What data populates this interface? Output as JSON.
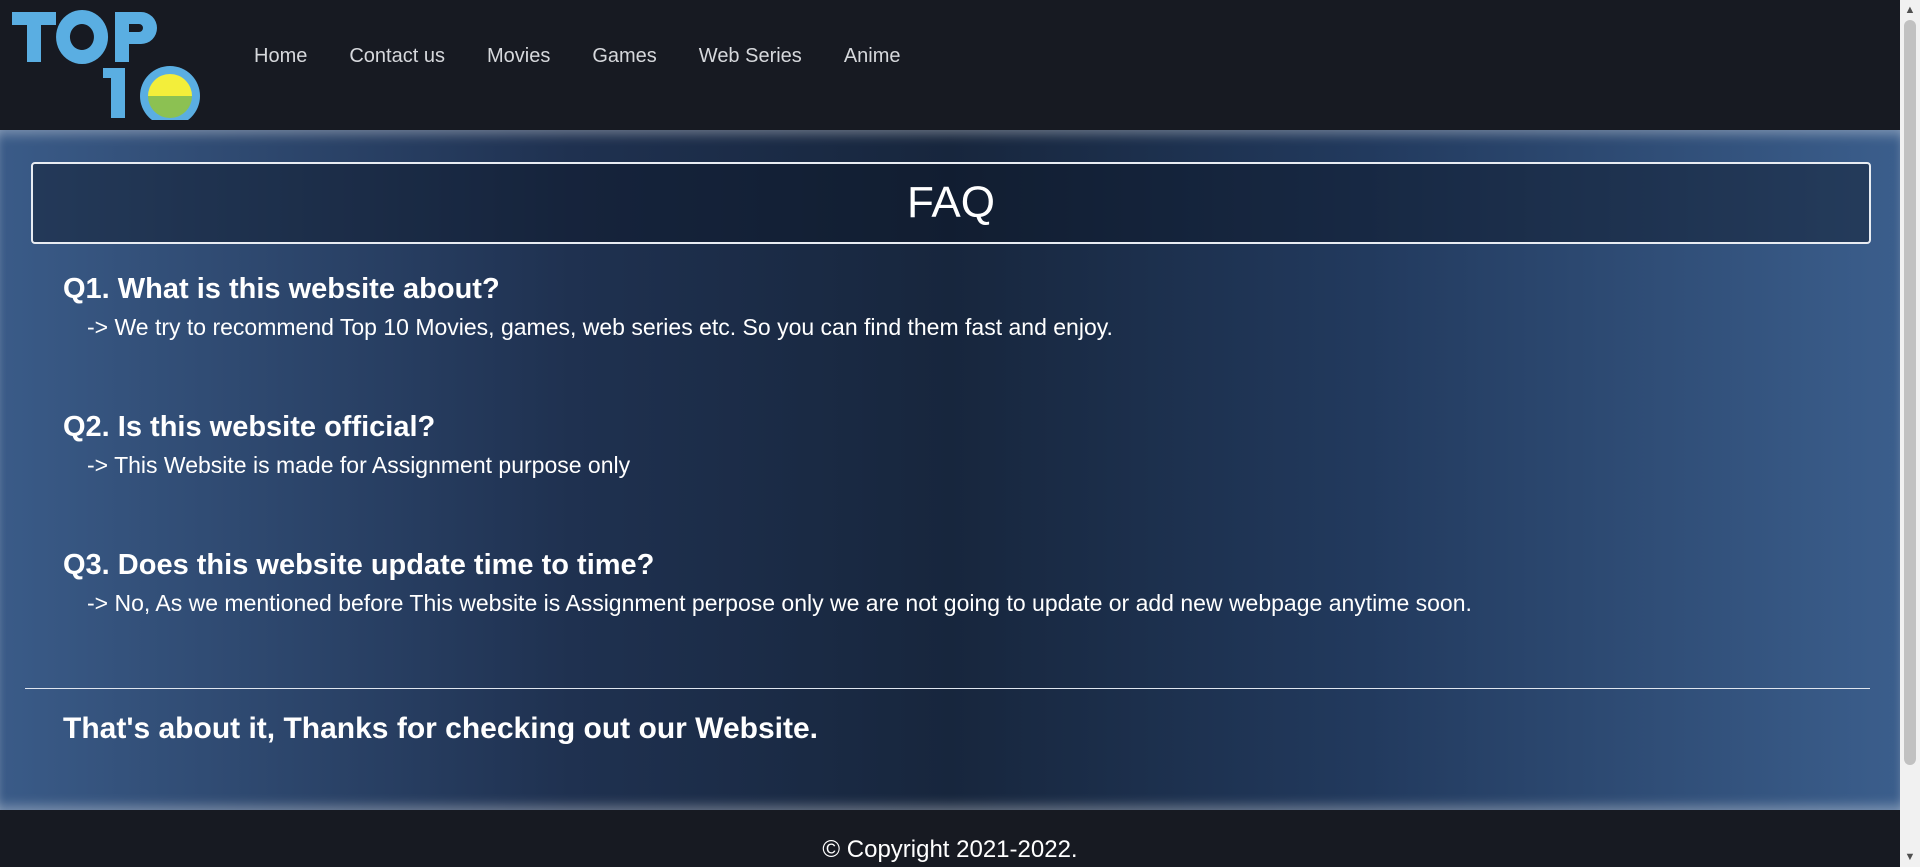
{
  "nav": {
    "items": [
      "Home",
      "Contact us",
      "Movies",
      "Games",
      "Web Series",
      "Anime"
    ]
  },
  "logo": {
    "text": "TOP 10",
    "colors": {
      "letters": "#5aaee2",
      "sun": "#f3ee3a",
      "ground": "#8cc152"
    }
  },
  "faq": {
    "title": "FAQ",
    "items": [
      {
        "question": "Q1. What is this website about?",
        "answer": "-> We try to recommend Top 10 Movies, games, web series etc. So you can find them fast and enjoy."
      },
      {
        "question": "Q2. Is this website official?",
        "answer": "-> This Website is made for Assignment purpose only"
      },
      {
        "question": "Q3. Does this website update time to time?",
        "answer": "-> No, As we mentioned before This website is Assignment perpose only we are not going to update or add new webpage anytime soon."
      }
    ]
  },
  "closing": "That's about it, Thanks for checking out our Website.",
  "footer": {
    "copyright": "© Copyright 2021-2022."
  },
  "scrollbar": {
    "up": "▲",
    "down": "▼"
  }
}
